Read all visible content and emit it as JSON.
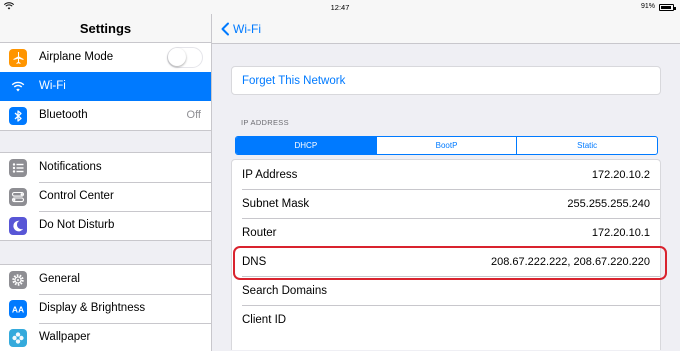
{
  "status_bar": {
    "time": "12:47",
    "battery": "91%",
    "battery_level": 0.91
  },
  "sidebar": {
    "title": "Settings",
    "groups": [
      [
        {
          "label": "Airplane Mode",
          "icon": "airplane-icon",
          "color": "#ff9500",
          "accessory": "toggle",
          "toggle_on": false
        },
        {
          "label": "Wi-Fi",
          "icon": "wifi-icon",
          "color": "#007aff",
          "selected": true
        },
        {
          "label": "Bluetooth",
          "icon": "bluetooth-icon",
          "color": "#007aff",
          "value": "Off"
        }
      ],
      [
        {
          "label": "Notifications",
          "icon": "notifications-icon",
          "color": "#8e8e93"
        },
        {
          "label": "Control Center",
          "icon": "control-center-icon",
          "color": "#8e8e93"
        },
        {
          "label": "Do Not Disturb",
          "icon": "moon-icon",
          "color": "#5856d6"
        }
      ],
      [
        {
          "label": "General",
          "icon": "gear-icon",
          "color": "#8e8e93"
        },
        {
          "label": "Display & Brightness",
          "icon": "display-icon",
          "color": "#007aff"
        },
        {
          "label": "Wallpaper",
          "icon": "wallpaper-icon",
          "color": "#34aadc"
        }
      ]
    ]
  },
  "detail": {
    "back_label": "Wi-Fi",
    "forget_label": "Forget This Network",
    "section_header": "IP ADDRESS",
    "segments": [
      "DHCP",
      "BootP",
      "Static"
    ],
    "active_segment": 0,
    "rows": [
      {
        "key": "IP Address",
        "value": "172.20.10.2"
      },
      {
        "key": "Subnet Mask",
        "value": "255.255.255.240"
      },
      {
        "key": "Router",
        "value": "172.20.10.1"
      },
      {
        "key": "DNS",
        "value": "208.67.222.222, 208.67.220.220",
        "highlighted": true
      },
      {
        "key": "Search Domains",
        "value": ""
      },
      {
        "key": "Client ID",
        "value": ""
      }
    ]
  },
  "colors": {
    "accent": "#007aff",
    "highlight": "#d9232e",
    "background": "#efeff4"
  }
}
